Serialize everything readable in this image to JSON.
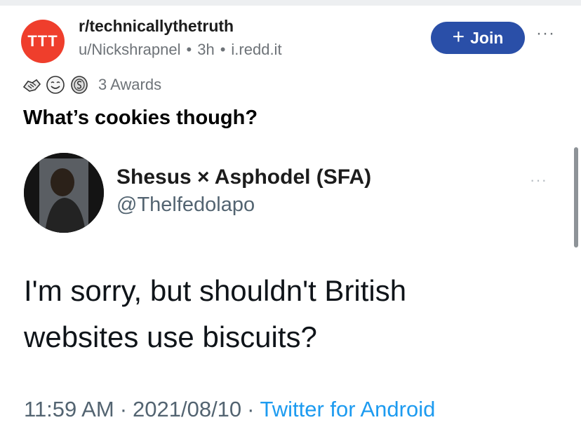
{
  "post": {
    "subreddit_icon_text": "TTT",
    "subreddit": "r/technicallythetruth",
    "author": "u/Nickshrapnel",
    "age": "3h",
    "domain": "i.redd.it",
    "join_label": "Join",
    "more": "···",
    "awards_label": "3 Awards",
    "award_icons": [
      "handshake-award-icon",
      "wholesome-award-icon",
      "silver-coin-award-icon"
    ],
    "title": "What’s cookies though?"
  },
  "tweet": {
    "display_name": "Shesus × Asphodel (SFA)",
    "handle": "@Thelfedolapo",
    "more": "···",
    "text_line1": "I'm sorry, but shouldn't British",
    "text_line2": "websites use biscuits?",
    "time": "11:59 AM",
    "date": "2021/08/10",
    "source": "Twitter for Android"
  },
  "colors": {
    "subreddit_icon": "#ef3e2c",
    "join_button": "#2a4fa8",
    "meta_text": "#6e7378",
    "twitter_link": "#1d9bf0",
    "twitter_gray": "#536471"
  }
}
